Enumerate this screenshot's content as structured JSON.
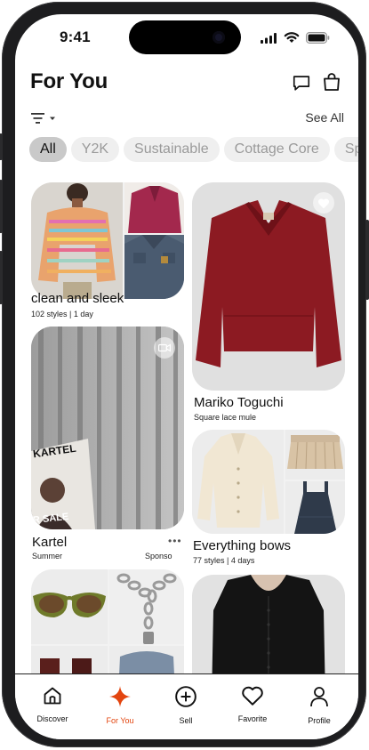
{
  "status_bar": {
    "time": "9:41"
  },
  "header": {
    "title": "For You",
    "see_all": "See All"
  },
  "chips": [
    "All",
    "Y2K",
    "Sustainable",
    "Cottage Core",
    "Sp"
  ],
  "feed": {
    "card1": {
      "title": "clean and sleek",
      "meta": "102 styles | 1 day"
    },
    "card2": {
      "title": "Mariko Toguchi",
      "meta": "Square lace mule"
    },
    "card3": {
      "title": "Kartel",
      "meta": "Summer",
      "sponsor": "Sponso",
      "more": "•••",
      "overlay_top": "KARTEL",
      "overlay_bottom": "R SALE"
    },
    "card4": {
      "title": "Everything bows",
      "meta": "77 styles | 4 days"
    }
  },
  "tabs": [
    {
      "label": "Discover",
      "icon": "home-icon"
    },
    {
      "label": "For You",
      "icon": "sparkle-icon"
    },
    {
      "label": "Sell",
      "icon": "plus-circle-icon"
    },
    {
      "label": "Favorite",
      "icon": "heart-icon"
    },
    {
      "label": "Profile",
      "icon": "profile-icon"
    }
  ],
  "colors": {
    "accent": "#e3450f",
    "chip_active": "#c9c9c9",
    "chip_bg": "#efefef"
  }
}
